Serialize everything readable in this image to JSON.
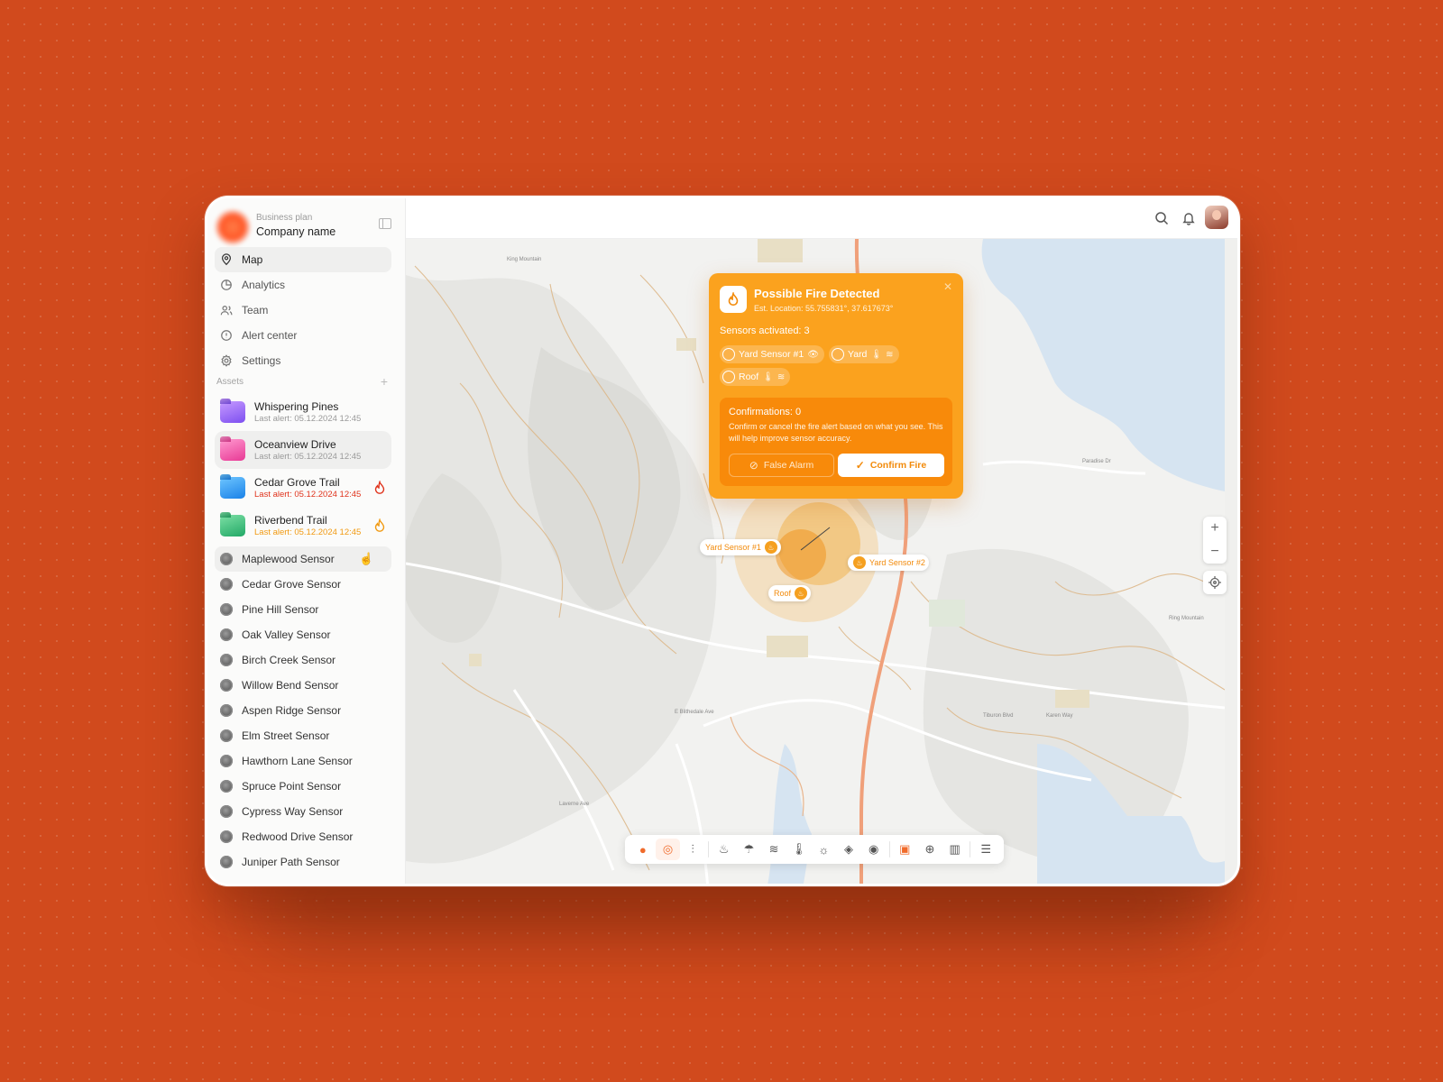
{
  "brand": {
    "plan": "Business plan",
    "company": "Company name"
  },
  "nav": [
    {
      "label": "Map",
      "icon": "map-pin-icon",
      "active": true
    },
    {
      "label": "Analytics",
      "icon": "pie-chart-icon"
    },
    {
      "label": "Team",
      "icon": "users-icon"
    },
    {
      "label": "Alert center",
      "icon": "alert-circle-icon"
    },
    {
      "label": "Settings",
      "icon": "gear-icon"
    }
  ],
  "assets_label": "Assets",
  "assets": [
    {
      "name": "Whispering Pines",
      "last": "Last alert: 05.12.2024 12:45",
      "color": "#a06bf0",
      "status": "none"
    },
    {
      "name": "Oceanview Drive",
      "last": "Last alert: 05.12.2024 12:45",
      "color": "#f060b0",
      "status": "none"
    },
    {
      "name": "Cedar Grove Trail",
      "last": "Last alert: 05.12.2024 12:45",
      "color": "#2f9ff0",
      "status": "red"
    },
    {
      "name": "Riverbend Trail",
      "last": "Last alert: 05.12.2024 12:45",
      "color": "#3cc27a",
      "status": "orange"
    }
  ],
  "sensors": [
    "Maplewood Sensor",
    "Cedar Grove Sensor",
    "Pine Hill Sensor",
    "Oak Valley Sensor",
    "Birch Creek Sensor",
    "Willow Bend Sensor",
    "Aspen Ridge Sensor",
    "Elm Street Sensor",
    "Hawthorn Lane Sensor",
    "Spruce Point Sensor",
    "Cypress Way Sensor",
    "Redwood Drive Sensor",
    "Juniper Path Sensor"
  ],
  "alert": {
    "title": "Possible Fire Detected",
    "location": "Est. Location: 55.755831°, 37.617673°",
    "sensors_activated": "Sensors activated: 3",
    "chips": [
      "Yard Sensor #1",
      "Yard",
      "Roof"
    ],
    "confirmations": "Confirmations: 0",
    "description": "Confirm or cancel the fire alert based on what you see. This will help improve sensor accuracy.",
    "false_alarm": "False Alarm",
    "confirm_fire": "Confirm Fire"
  },
  "map_labels": {
    "sensor1": "Yard Sensor #1",
    "sensor2": "Yard Sensor #2",
    "roof": "Roof"
  },
  "colors": {
    "accent": "#fba21e",
    "danger": "#e0331c",
    "warning": "#f19a12",
    "background": "#d14a1d"
  }
}
